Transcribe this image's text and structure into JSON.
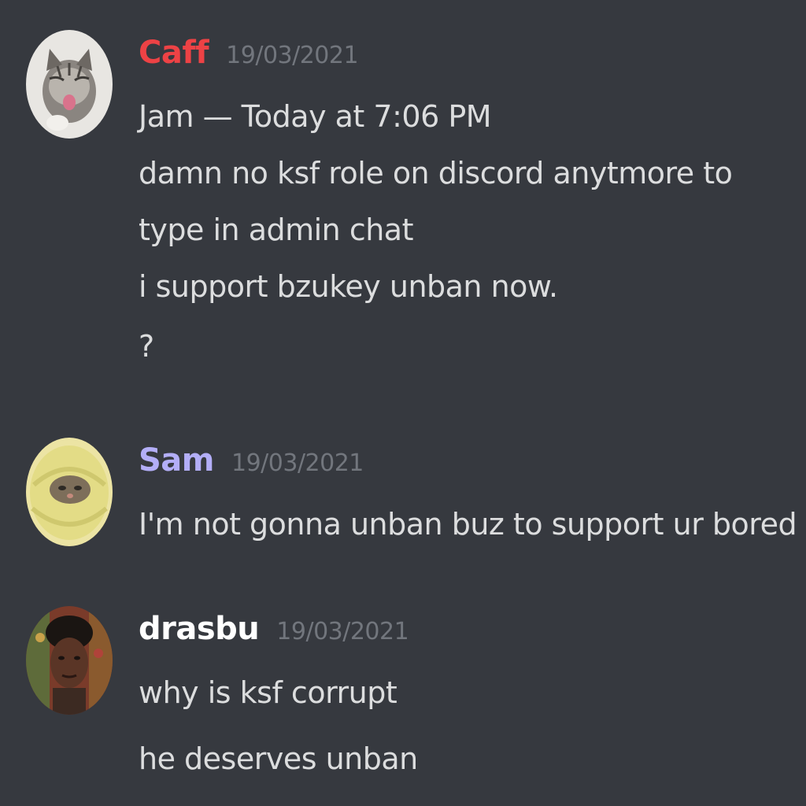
{
  "messages": [
    {
      "username": "Caff",
      "username_color": "#ed4245",
      "timestamp": "19/03/2021",
      "avatar_icon": "kitten-avatar-icon",
      "lines": [
        "Jam — Today at 7:06 PM",
        "damn no ksf role on discord anytmore to",
        "type in admin chat",
        "i support bzukey unban now.",
        "?"
      ]
    },
    {
      "username": "Sam",
      "username_color": "#b3aef7",
      "timestamp": "19/03/2021",
      "avatar_icon": "cat-in-towel-avatar-icon",
      "lines": [
        "I'm not gonna unban buz to support ur bored"
      ]
    },
    {
      "username": "drasbu",
      "username_color": "#ffffff",
      "timestamp": "19/03/2021",
      "avatar_icon": "person-photo-avatar-icon",
      "lines": [
        "why is ksf corrupt",
        "he deserves unban"
      ]
    }
  ]
}
